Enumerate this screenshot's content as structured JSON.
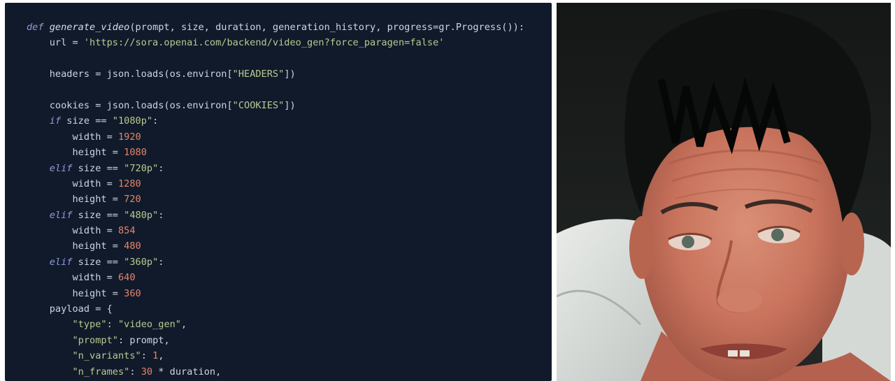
{
  "code": {
    "lines": [
      [
        {
          "t": "def",
          "c": "kw"
        },
        {
          "t": " "
        },
        {
          "t": "generate_video",
          "c": "fn"
        },
        {
          "t": "(prompt, size, duration, generation_history, progress=gr.Progress()):"
        }
      ],
      [
        {
          "t": "    url = "
        },
        {
          "t": "'https://sora.openai.com/backend/video_gen?force_paragen=false'",
          "c": "str"
        }
      ],
      [],
      [
        {
          "t": "    headers = json.loads(os.environ["
        },
        {
          "t": "\"HEADERS\"",
          "c": "str"
        },
        {
          "t": "])"
        }
      ],
      [],
      [
        {
          "t": "    cookies = json.loads(os.environ["
        },
        {
          "t": "\"COOKIES\"",
          "c": "str"
        },
        {
          "t": "])"
        }
      ],
      [
        {
          "t": "    "
        },
        {
          "t": "if",
          "c": "kw"
        },
        {
          "t": " size == "
        },
        {
          "t": "\"1080p\"",
          "c": "str"
        },
        {
          "t": ":"
        }
      ],
      [
        {
          "t": "        width = "
        },
        {
          "t": "1920",
          "c": "num"
        }
      ],
      [
        {
          "t": "        height = "
        },
        {
          "t": "1080",
          "c": "num"
        }
      ],
      [
        {
          "t": "    "
        },
        {
          "t": "elif",
          "c": "kw"
        },
        {
          "t": " size == "
        },
        {
          "t": "\"720p\"",
          "c": "str"
        },
        {
          "t": ":"
        }
      ],
      [
        {
          "t": "        width = "
        },
        {
          "t": "1280",
          "c": "num"
        }
      ],
      [
        {
          "t": "        height = "
        },
        {
          "t": "720",
          "c": "num"
        }
      ],
      [
        {
          "t": "    "
        },
        {
          "t": "elif",
          "c": "kw"
        },
        {
          "t": " size == "
        },
        {
          "t": "\"480p\"",
          "c": "str"
        },
        {
          "t": ":"
        }
      ],
      [
        {
          "t": "        width = "
        },
        {
          "t": "854",
          "c": "num"
        }
      ],
      [
        {
          "t": "        height = "
        },
        {
          "t": "480",
          "c": "num"
        }
      ],
      [
        {
          "t": "    "
        },
        {
          "t": "elif",
          "c": "kw"
        },
        {
          "t": " size == "
        },
        {
          "t": "\"360p\"",
          "c": "str"
        },
        {
          "t": ":"
        }
      ],
      [
        {
          "t": "        width = "
        },
        {
          "t": "640",
          "c": "num"
        }
      ],
      [
        {
          "t": "        height = "
        },
        {
          "t": "360",
          "c": "num"
        }
      ],
      [
        {
          "t": "    payload = {"
        }
      ],
      [
        {
          "t": "        "
        },
        {
          "t": "\"type\"",
          "c": "str"
        },
        {
          "t": ": "
        },
        {
          "t": "\"video_gen\"",
          "c": "str"
        },
        {
          "t": ","
        }
      ],
      [
        {
          "t": "        "
        },
        {
          "t": "\"prompt\"",
          "c": "str"
        },
        {
          "t": ": prompt,"
        }
      ],
      [
        {
          "t": "        "
        },
        {
          "t": "\"n_variants\"",
          "c": "str"
        },
        {
          "t": ": "
        },
        {
          "t": "1",
          "c": "num"
        },
        {
          "t": ","
        }
      ],
      [
        {
          "t": "        "
        },
        {
          "t": "\"n_frames\"",
          "c": "str"
        },
        {
          "t": ": "
        },
        {
          "t": "30",
          "c": "num"
        },
        {
          "t": " * duration,"
        }
      ]
    ]
  },
  "photo": {
    "subject": "portrait-photo"
  },
  "colors": {
    "code_background": "#111a2b",
    "keyword": "#8f9bd9",
    "string": "#b9c98f",
    "number": "#e4856a",
    "plain": "#cdd5e2"
  }
}
